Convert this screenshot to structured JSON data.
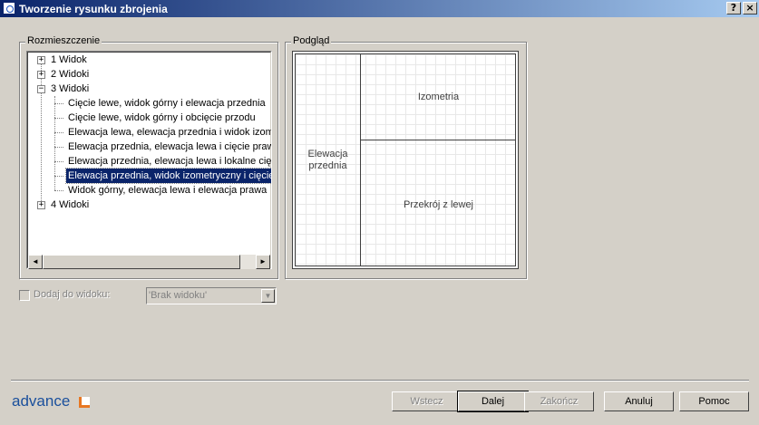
{
  "window": {
    "title": "Tworzenie rysunku zbrojenia",
    "help_button": "?",
    "close_button": "×"
  },
  "layout_group": {
    "legend": "Rozmieszczenie",
    "tree": [
      {
        "label": "1 Widok",
        "expander": "+"
      },
      {
        "label": "2 Widoki",
        "expander": "+"
      },
      {
        "label": "3 Widoki",
        "expander": "−"
      },
      {
        "label": "Cięcie lewe, widok górny i elewacja przednia"
      },
      {
        "label": "Cięcie lewe, widok górny i obcięcie przodu"
      },
      {
        "label": "Elewacja lewa, elewacja przednia i widok izome"
      },
      {
        "label": "Elewacja przednia, elewacja lewa i cięcie prawe"
      },
      {
        "label": "Elewacja przednia, elewacja lewa i lokalne cięc"
      },
      {
        "label": "Elewacja przednia, widok izometryczny i cięcie l",
        "selected": true
      },
      {
        "label": "Widok górny, elewacja lewa i elewacja prawa"
      },
      {
        "label": "4 Widoki",
        "expander": "+"
      }
    ],
    "scroll_left": "◄",
    "scroll_right": "►"
  },
  "preview_group": {
    "legend": "Podgląd",
    "panes": {
      "left": "Elewacja\nprzednia",
      "top_right": "Izometria",
      "bottom_right": "Przekrój z lewej"
    }
  },
  "add_to_view": {
    "label": "Dodaj do widoku:",
    "checked": false,
    "combo_value": "'Brak widoku'",
    "combo_arrow": "▼"
  },
  "footer": {
    "logo": "advance",
    "buttons": {
      "back": "Wstecz",
      "next": "Dalej",
      "finish": "Zakończ",
      "cancel": "Anuluj",
      "help": "Pomoc"
    }
  },
  "colors": {
    "selection": "#0a246a",
    "face": "#d4d0c8",
    "logo_blue": "#1a4f9c",
    "logo_orange": "#e87722"
  }
}
